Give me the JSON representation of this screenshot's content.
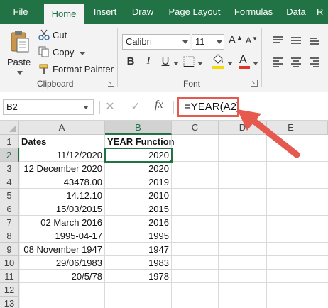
{
  "ribbon_tabs": [
    "File",
    "Home",
    "Insert",
    "Draw",
    "Page Layout",
    "Formulas",
    "Data",
    "R"
  ],
  "active_tab": "Home",
  "clipboard": {
    "paste_label": "Paste",
    "cut_label": "Cut",
    "copy_label": "Copy",
    "format_painter_label": "Format Painter",
    "group_label": "Clipboard"
  },
  "font": {
    "font_name": "Calibri",
    "font_size": "11",
    "group_label": "Font",
    "bold_label": "B",
    "italic_label": "I",
    "underline_label": "U",
    "font_color_label": "A",
    "highlight_color": "#f5d90a",
    "font_color": "#e0352b"
  },
  "formula_bar": {
    "name_box": "B2",
    "fx_label": "fx",
    "formula": "=YEAR(A2)"
  },
  "columns": [
    "A",
    "B",
    "C",
    "D",
    "E"
  ],
  "selected_column": "B",
  "rows": [
    "1",
    "2",
    "3",
    "4",
    "5",
    "6",
    "7",
    "8",
    "9",
    "10",
    "11",
    "12",
    "13"
  ],
  "selected_row": "2",
  "table": {
    "header": {
      "a": "Dates",
      "b": "YEAR Function"
    },
    "data": [
      {
        "a": "11/12/2020",
        "b": "2020"
      },
      {
        "a": "12 December 2020",
        "b": "2020"
      },
      {
        "a": "43478.00",
        "b": "2019"
      },
      {
        "a": "14.12.10",
        "b": "2010"
      },
      {
        "a": "15/03/2015",
        "b": "2015"
      },
      {
        "a": "02 March 2016",
        "b": "2016"
      },
      {
        "a": "1995-04-17",
        "b": "1995"
      },
      {
        "a": "08 November 1947",
        "b": "1947"
      },
      {
        "a": "29/06/1983",
        "b": "1983"
      },
      {
        "a": "20/5/78",
        "b": "1978"
      }
    ]
  },
  "colors": {
    "excel_green": "#217346",
    "annotation_red": "#e6594e"
  }
}
